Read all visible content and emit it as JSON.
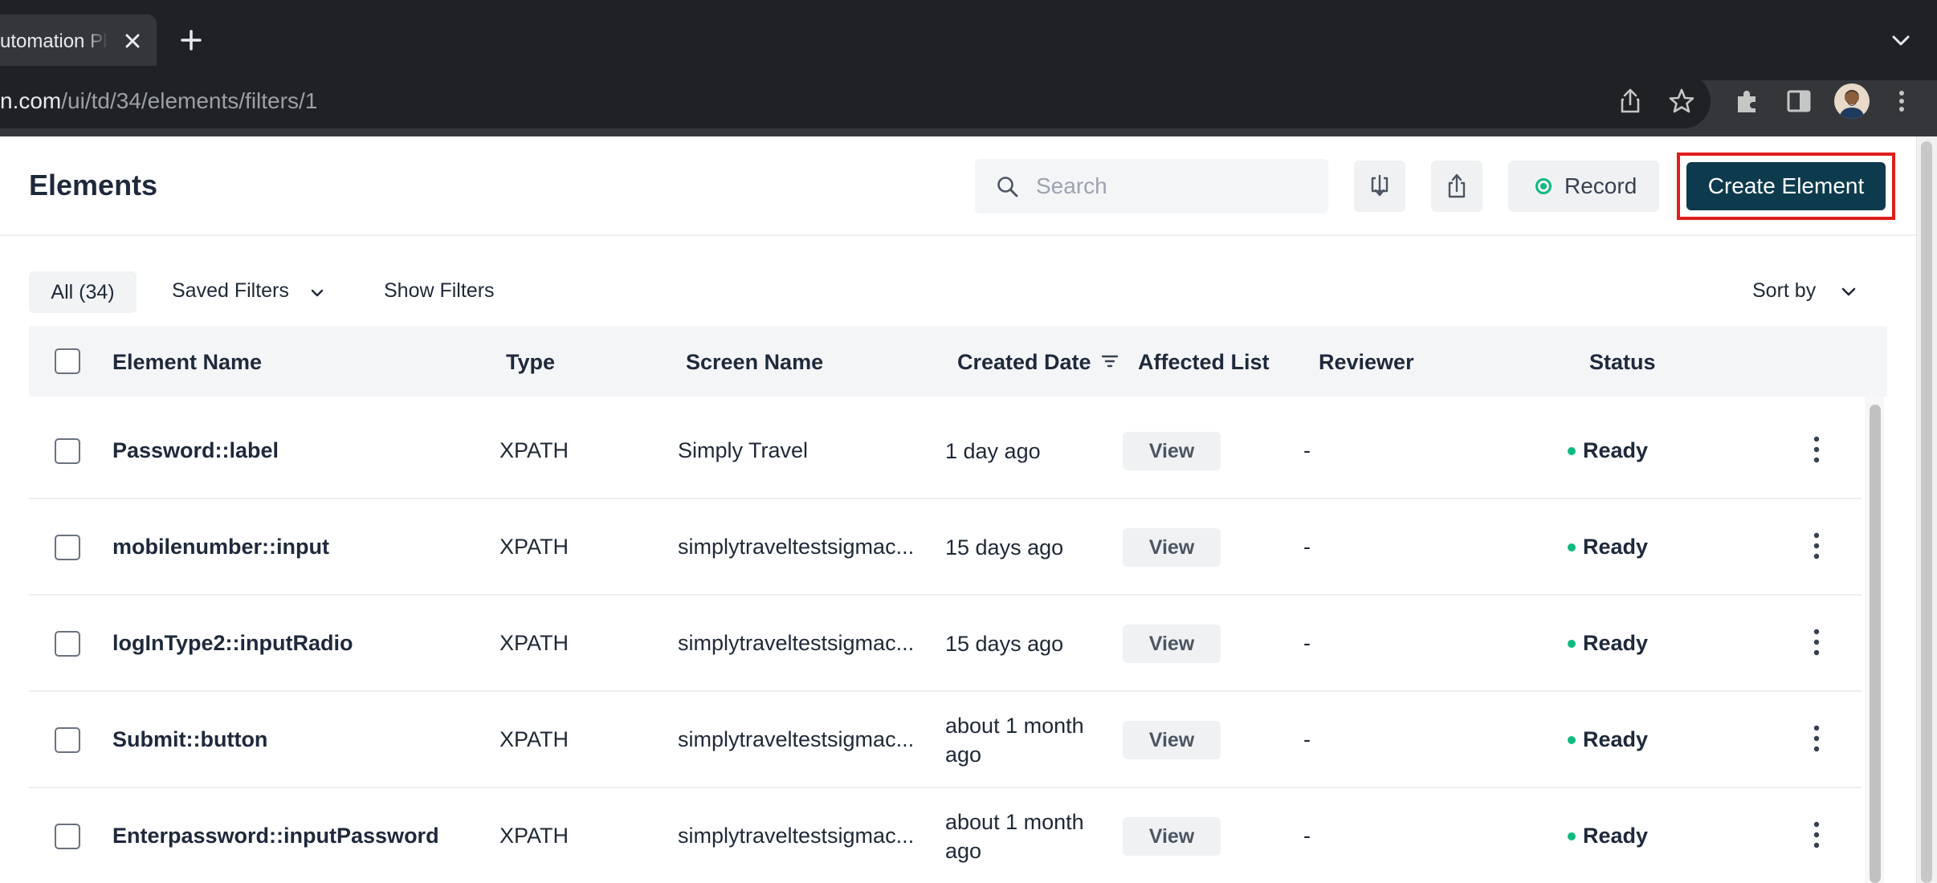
{
  "browser": {
    "tab_title": "utomation Pl",
    "url_host": "n.com",
    "url_path": "/ui/td/34/elements/filters/1"
  },
  "header": {
    "title": "Elements",
    "search_placeholder": "Search",
    "record_label": "Record",
    "create_label": "Create Element"
  },
  "filters": {
    "all_label": "All (34)",
    "saved_filters_label": "Saved Filters",
    "show_filters_label": "Show Filters",
    "sort_by_label": "Sort by"
  },
  "table": {
    "columns": [
      "Element Name",
      "Type",
      "Screen Name",
      "Created Date",
      "Affected List",
      "Reviewer",
      "Status"
    ],
    "view_label": "View",
    "rows": [
      {
        "name": "Password::label",
        "type": "XPATH",
        "screen": "Simply Travel",
        "created": "1 day ago",
        "reviewer": "-",
        "status": "Ready"
      },
      {
        "name": "mobilenumber::input",
        "type": "XPATH",
        "screen": "simplytraveltestsigmac...",
        "created": "15 days ago",
        "reviewer": "-",
        "status": "Ready"
      },
      {
        "name": "logInType2::inputRadio",
        "type": "XPATH",
        "screen": "simplytraveltestsigmac...",
        "created": "15 days ago",
        "reviewer": "-",
        "status": "Ready"
      },
      {
        "name": "Submit::button",
        "type": "XPATH",
        "screen": "simplytraveltestsigmac...",
        "created": "about 1 month ago",
        "reviewer": "-",
        "status": "Ready"
      },
      {
        "name": "Enterpassword::inputPassword",
        "type": "XPATH",
        "screen": "simplytraveltestsigmac...",
        "created": "about 1 month ago",
        "reviewer": "-",
        "status": "Ready"
      }
    ]
  },
  "colors": {
    "primary": "#0d3b4d",
    "highlight": "#e11d1d",
    "status_ready": "#10b981"
  }
}
